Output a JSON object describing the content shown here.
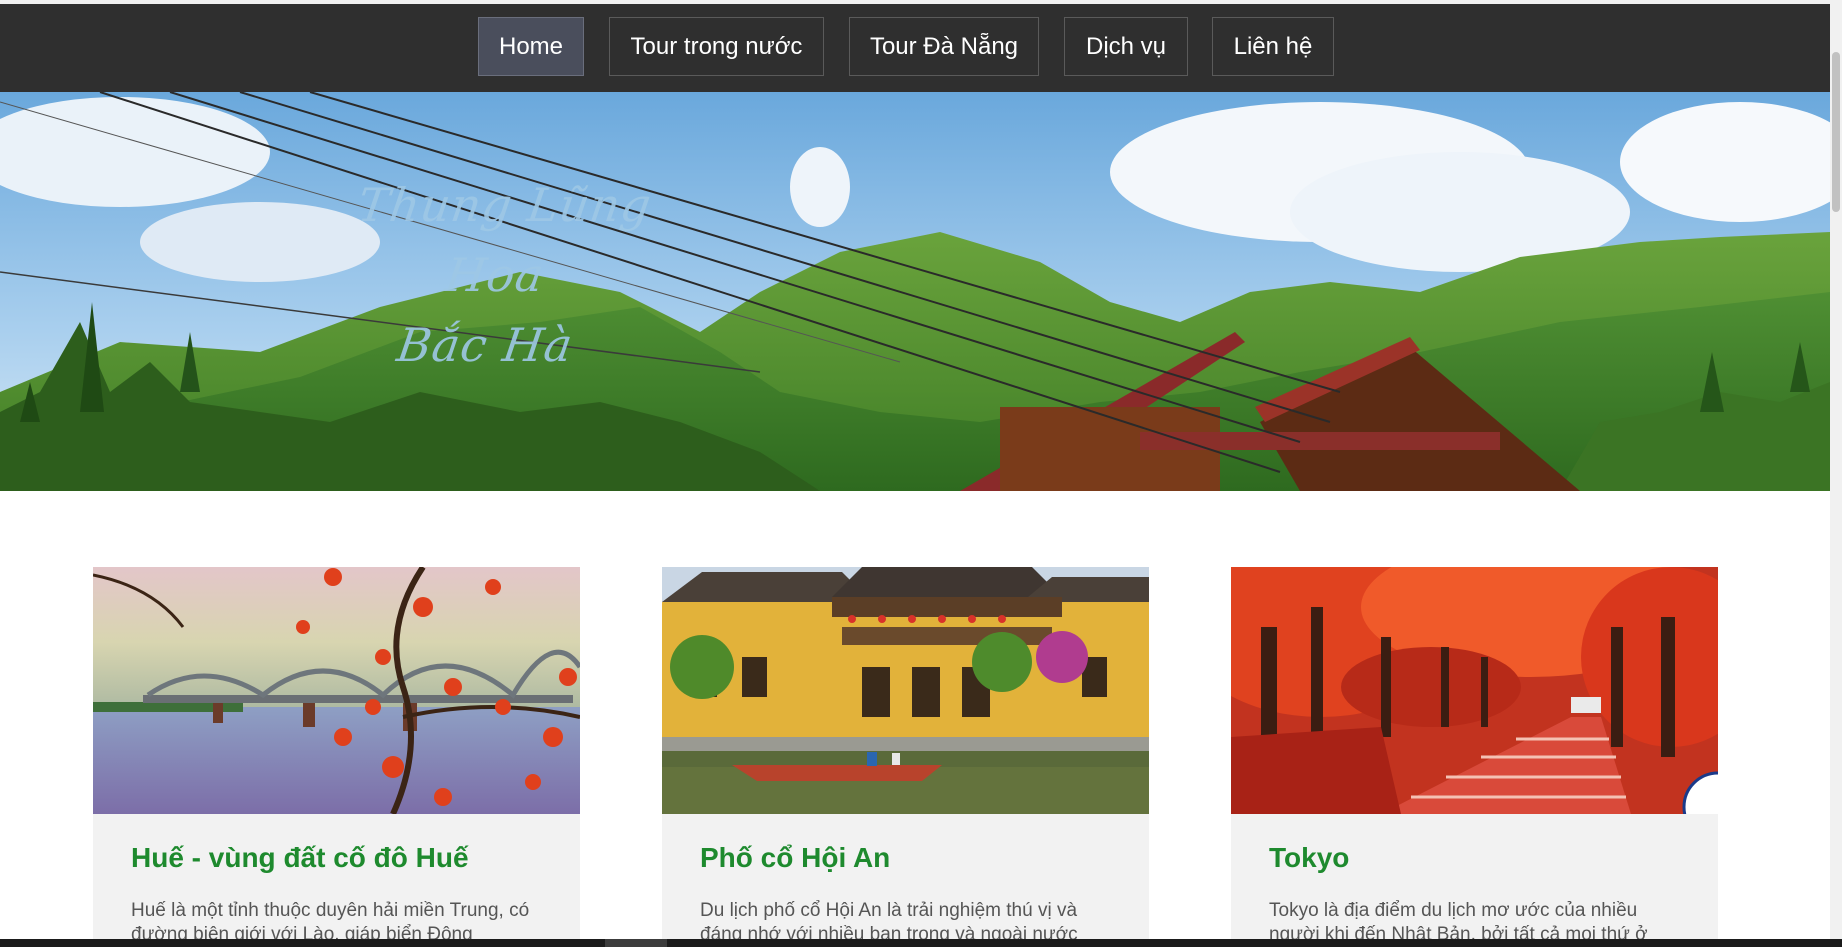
{
  "nav": {
    "items": [
      {
        "label": "Home",
        "active": true
      },
      {
        "label": "Tour trong nước",
        "active": false
      },
      {
        "label": "Tour Đà Nẵng",
        "active": false
      },
      {
        "label": "Dịch vụ",
        "active": false
      },
      {
        "label": "Liên hệ",
        "active": false
      }
    ]
  },
  "hero": {
    "caption_line1": "Thung Lũng Hoa",
    "caption_line2": "Bắc Hà",
    "image": "mountain-valley-landscape"
  },
  "cards": [
    {
      "title": "Huế - vùng đất cố đô Huế",
      "desc": "Huế là một tỉnh thuộc duyên hải miền Trung, có đường biên giới với Lào, giáp biển Đông",
      "image": "hue-bridge-flowers"
    },
    {
      "title": "Phố cổ Hội An",
      "desc": "Du lịch phố cổ Hội An là trải nghiệm thú vị và đáng nhớ với nhiều bạn trong và ngoài nước",
      "image": "hoi-an-old-town"
    },
    {
      "title": "Tokyo",
      "desc": "Tokyo là địa điểm du lịch mơ ước của nhiều người khi đến Nhật Bản, bởi tất cả mọi thứ ở",
      "image": "tokyo-red-maple-path"
    }
  ],
  "colors": {
    "nav_bg": "#2f2f2f",
    "nav_active": "#4a4e5c",
    "card_title": "#1e8a2e",
    "card_bg": "#f2f2f2"
  }
}
